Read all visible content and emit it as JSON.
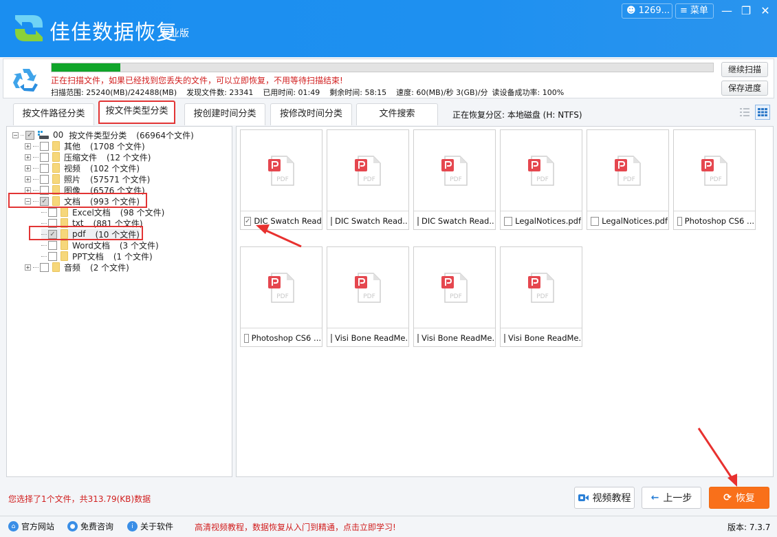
{
  "app": {
    "title": "佳佳数据恢复",
    "edition": "专业版",
    "user_label": "1269...",
    "menu_label": "菜单",
    "brand_color": "#1e90f0"
  },
  "scan": {
    "progress_percent": 10.4,
    "message": "正在扫描文件，如果已经找到您丢失的文件，可以立即恢复，不用等待扫描结束!",
    "stats": [
      "扫描范围: 25240(MB)/242488(MB)",
      "发现文件数: 23341",
      "已用时间: 01:49",
      "剩余时间: 58:15",
      "速度: 60(MB)/秒  3(GB)/分",
      "读设备成功率: 100%"
    ],
    "continue_label": "继续扫描",
    "save_label": "保存进度"
  },
  "tabs": [
    {
      "label": "按文件路径分类",
      "active": false
    },
    {
      "label": "按文件类型分类",
      "active": true
    },
    {
      "label": "按创建时间分类",
      "active": false
    },
    {
      "label": "按修改时间分类",
      "active": false
    },
    {
      "label": "文件搜索",
      "active": false
    }
  ],
  "partition": "正在恢复分区: 本地磁盘 (H: NTFS)",
  "tree": {
    "root": {
      "prefix": "00",
      "label": "按文件类型分类",
      "count": "(66964个文件)"
    },
    "items": [
      {
        "label": "其他",
        "count": "(1708 个文件)"
      },
      {
        "label": "压缩文件",
        "count": "(12 个文件)"
      },
      {
        "label": "视频",
        "count": "(102 个文件)"
      },
      {
        "label": "照片",
        "count": "(57571 个文件)"
      },
      {
        "label": "图像",
        "count": "(6576 个文件)"
      },
      {
        "label": "文档",
        "count": "(993 个文件)"
      },
      {
        "label": "Excel文档",
        "count": "(98 个文件)"
      },
      {
        "label": "txt",
        "count": "(881 个文件)"
      },
      {
        "label": "pdf",
        "count": "(10 个文件)"
      },
      {
        "label": "Word文档",
        "count": "(3 个文件)"
      },
      {
        "label": "PPT文档",
        "count": "(1 个文件)"
      },
      {
        "label": "音频",
        "count": "(2 个文件)"
      }
    ]
  },
  "files": [
    {
      "name": "DIC Swatch Read...",
      "checked": true
    },
    {
      "name": "DIC Swatch Read...",
      "checked": false
    },
    {
      "name": "DIC Swatch Read...",
      "checked": false
    },
    {
      "name": "LegalNotices.pdf",
      "checked": false
    },
    {
      "name": "LegalNotices.pdf",
      "checked": false
    },
    {
      "name": "Photoshop CS6 ...",
      "checked": false
    },
    {
      "name": "Photoshop CS6 ...",
      "checked": false
    },
    {
      "name": "Visi Bone ReadMe...",
      "checked": false
    },
    {
      "name": "Visi Bone ReadMe...",
      "checked": false
    },
    {
      "name": "Visi Bone ReadMe...",
      "checked": false
    }
  ],
  "file_icon_label": "PDF",
  "selection_info": "您选择了1个文件，共313.79(KB)数据",
  "actions": {
    "video_label": "视频教程",
    "prev_label": "上一步",
    "recover_label": "恢复"
  },
  "footer": {
    "links": [
      "官方网站",
      "免费咨询",
      "关于软件"
    ],
    "promo": "高清视频教程，数据恢复从入门到精通，点击立即学习!",
    "version": "版本: 7.3.7"
  }
}
